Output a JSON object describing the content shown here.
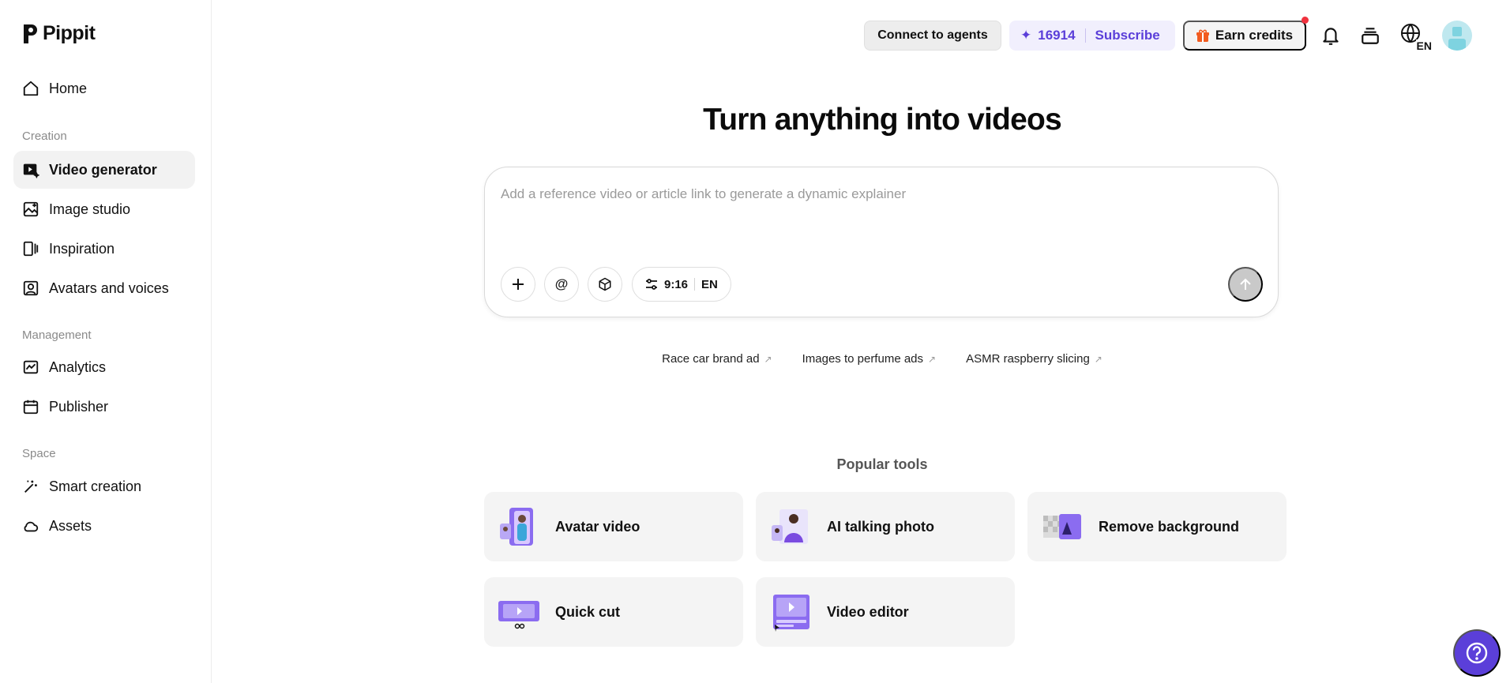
{
  "brand": {
    "name": "Pippit"
  },
  "sidebar": {
    "home": "Home",
    "sections": {
      "creation": "Creation",
      "management": "Management",
      "space": "Space"
    },
    "items": {
      "video_generator": "Video generator",
      "image_studio": "Image studio",
      "inspiration": "Inspiration",
      "avatars_voices": "Avatars and voices",
      "analytics": "Analytics",
      "publisher": "Publisher",
      "smart_creation": "Smart creation",
      "assets": "Assets"
    },
    "active": "video_generator"
  },
  "topbar": {
    "connect_agents": "Connect to agents",
    "credits": "16914",
    "subscribe": "Subscribe",
    "earn_credits": "Earn credits",
    "language": "EN"
  },
  "main": {
    "title": "Turn anything into videos",
    "prompt_placeholder": "Add a reference video or article link to generate a dynamic explainer",
    "aspect_ratio": "9:16",
    "language": "EN",
    "suggestions": [
      "Race car brand ad",
      "Images to perfume ads",
      "ASMR raspberry slicing"
    ],
    "popular_tools_label": "Popular tools",
    "tools": [
      "Avatar video",
      "AI talking photo",
      "Remove background",
      "Quick cut",
      "Video editor"
    ]
  },
  "colors": {
    "accent": "#5b3fd9",
    "accent_bg": "#f1effd",
    "notification": "#f0323e",
    "card_bg": "#f4f4f4"
  }
}
